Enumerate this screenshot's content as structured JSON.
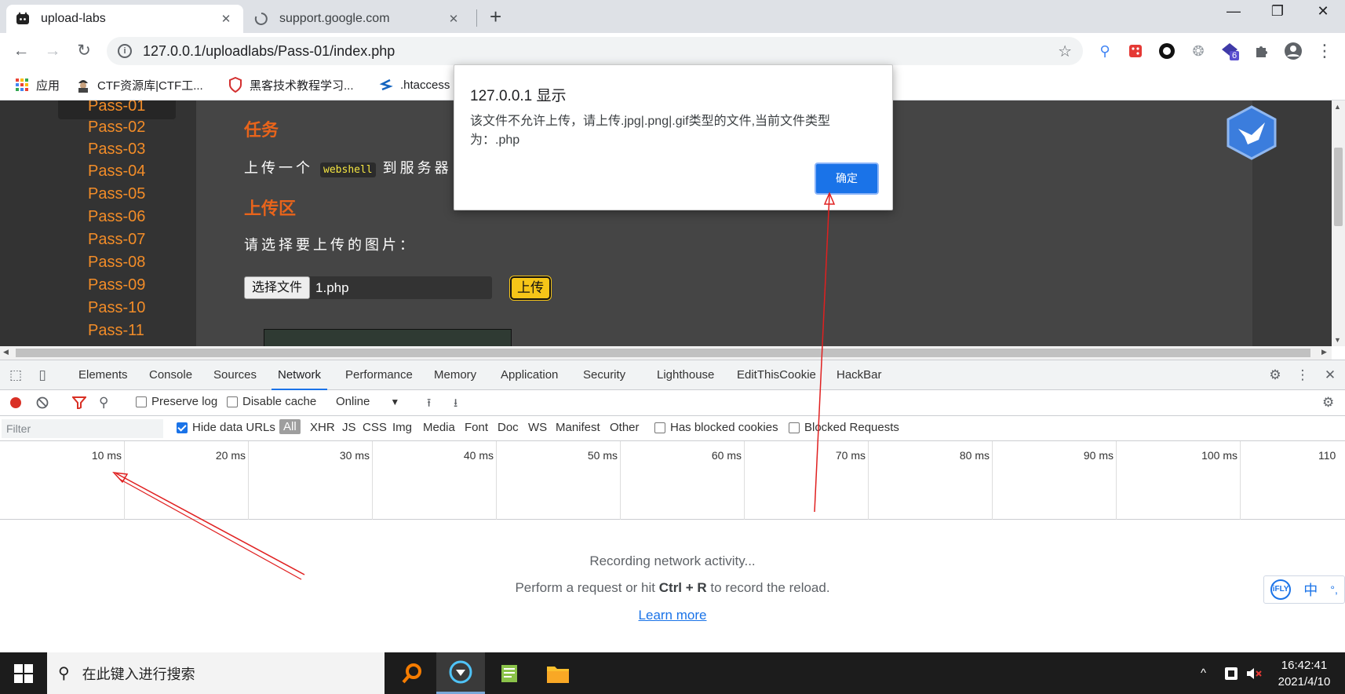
{
  "browser": {
    "tabs": [
      {
        "title": "upload-labs",
        "active": true
      },
      {
        "title": "support.google.com",
        "active": false
      }
    ],
    "new_tab": "+",
    "window_controls": {
      "minimize": "—",
      "restore": "❐",
      "close": "✕"
    },
    "url": "127.0.0.1/uploadlabs/Pass-01/index.php",
    "extension_badge": "6",
    "bookmarks": [
      {
        "label": "应用",
        "icon": "apps-grid-icon"
      },
      {
        "label": "CTF资源库|CTF工...",
        "icon": "hacker-icon"
      },
      {
        "label": "黑客技术教程学习...",
        "icon": "shield-icon"
      },
      {
        "label": ".htaccess",
        "icon": "s-logo-icon"
      }
    ]
  },
  "page": {
    "sidebar_items": [
      "Pass-01",
      "Pass-02",
      "Pass-03",
      "Pass-04",
      "Pass-05",
      "Pass-06",
      "Pass-07",
      "Pass-08",
      "Pass-09",
      "Pass-10",
      "Pass-11"
    ],
    "task_heading": "任务",
    "task_text_before": "上传一个",
    "task_code": "webshell",
    "task_text_after": "到服务器",
    "upload_heading": "上传区",
    "choose_prompt": "请选择要上传的图片：",
    "file_button": "选择文件",
    "file_name": "1.php",
    "upload_button": "上传"
  },
  "dialog": {
    "title": "127.0.0.1 显示",
    "message": "该文件不允许上传，请上传.jpg|.png|.gif类型的文件,当前文件类型为：.php",
    "ok_button": "确定"
  },
  "devtools": {
    "tabs": [
      "Elements",
      "Console",
      "Sources",
      "Network",
      "Performance",
      "Memory",
      "Application",
      "Security",
      "Lighthouse",
      "EditThisCookie",
      "HackBar"
    ],
    "active_tab": "Network",
    "preserve_log": "Preserve log",
    "disable_cache": "Disable cache",
    "throttling": "Online",
    "filter_placeholder": "Filter",
    "hide_data_urls": "Hide data URLs",
    "filter_types": [
      "All",
      "XHR",
      "JS",
      "CSS",
      "Img",
      "Media",
      "Font",
      "Doc",
      "WS",
      "Manifest",
      "Other"
    ],
    "has_blocked_cookies": "Has blocked cookies",
    "blocked_requests": "Blocked Requests",
    "timeline_labels": [
      "10 ms",
      "20 ms",
      "30 ms",
      "40 ms",
      "50 ms",
      "60 ms",
      "70 ms",
      "80 ms",
      "90 ms",
      "100 ms",
      "110"
    ],
    "recording": "Recording network activity...",
    "hint_before": "Perform a request or hit ",
    "hint_shortcut": "Ctrl + R",
    "hint_after": " to record the reload.",
    "learn_more": "Learn more"
  },
  "ime": {
    "logo": "iFLY",
    "lang": "中",
    "punct": "°,"
  },
  "taskbar": {
    "search_placeholder": "在此键入进行搜索",
    "time": "16:42:41",
    "date": "2021/4/10"
  }
}
